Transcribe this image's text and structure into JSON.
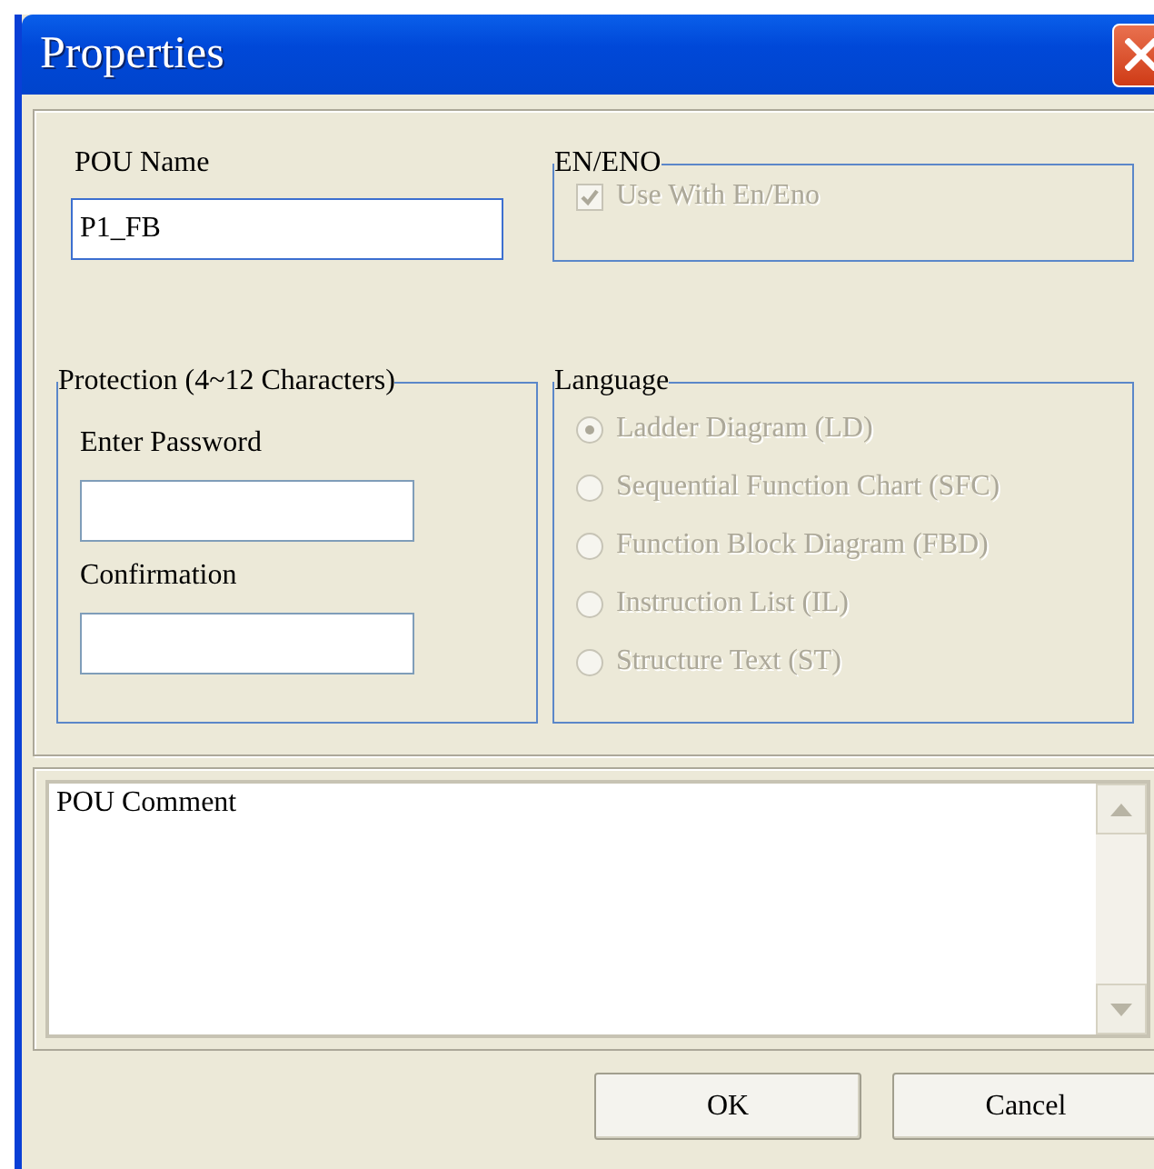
{
  "window": {
    "title": "Properties"
  },
  "pou_name": {
    "label": "POU Name",
    "value": "P1_FB"
  },
  "en_eno": {
    "title": "EN/ENO",
    "checkbox": {
      "label": "Use With En/Eno",
      "checked": true,
      "disabled": true
    }
  },
  "protection": {
    "title": "Protection (4~12 Characters)",
    "fields": [
      {
        "label": "Enter Password"
      },
      {
        "label": "Confirmation"
      }
    ]
  },
  "language": {
    "title": "Language",
    "disabled": true,
    "options": [
      {
        "label": "Ladder Diagram (LD)",
        "selected": true
      },
      {
        "label": "Sequential Function Chart (SFC)",
        "selected": false
      },
      {
        "label": "Function Block Diagram (FBD)",
        "selected": false
      },
      {
        "label": "Instruction List (IL)",
        "selected": false
      },
      {
        "label": "Structure Text (ST)",
        "selected": false
      }
    ]
  },
  "comment": {
    "value": "POU Comment"
  },
  "buttons": [
    "OK",
    "Cancel"
  ]
}
